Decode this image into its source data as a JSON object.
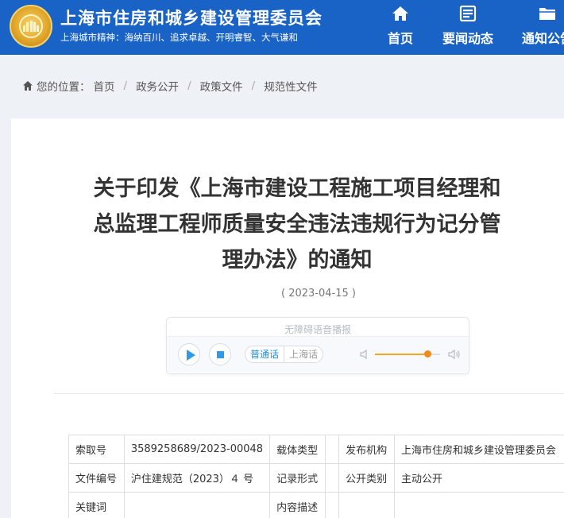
{
  "header": {
    "site_title": "上海市住房和城乡建设管理委员会",
    "motto": "上海城市精神：海纳百川、追求卓越、开明睿智、大气谦和",
    "logo_icon": "emblem-icon",
    "nav": [
      {
        "label": "首页",
        "icon": "home-icon"
      },
      {
        "label": "要闻动态",
        "icon": "news-icon"
      },
      {
        "label": "通知公告",
        "icon": "folder-icon"
      }
    ]
  },
  "breadcrumb": {
    "prefix": "您的位置：",
    "items": [
      "首页",
      "政务公开",
      "政策文件",
      "规范性文件"
    ]
  },
  "article": {
    "title": "关于印发《上海市建设工程施工项目经理和总监理工程师质量安全违法违规行为记分管理办法》的通知",
    "date": "( 2023-04-15 )"
  },
  "player": {
    "title": "无障碍语音播报",
    "languages": [
      "普通话",
      "上海话"
    ],
    "selected_language": "普通话",
    "volume": 0.8,
    "accent_color": "#2e9be8",
    "volume_color": "#f08a1a"
  },
  "info": {
    "rows": [
      [
        "索取号",
        "3589258689/2023-00048",
        "载体类型",
        "",
        "发布机构",
        "上海市住房和城乡建设管理委员会"
      ],
      [
        "文件编号",
        "沪住建规范（2023）４ 号",
        "记录形式",
        "",
        "公开类别",
        "主动公开"
      ],
      [
        "关键词",
        "",
        "内容描述",
        "",
        "",
        ""
      ]
    ]
  }
}
